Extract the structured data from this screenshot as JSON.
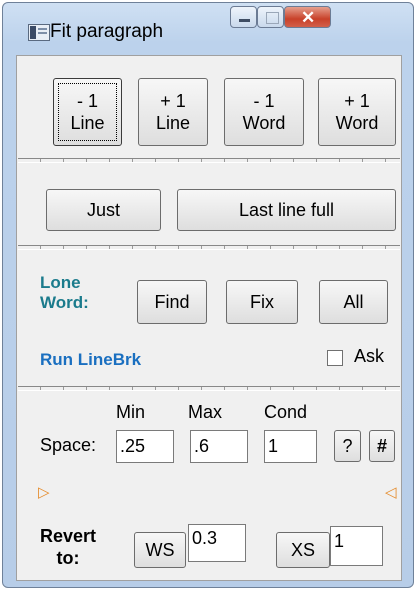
{
  "window": {
    "title": "Fit paragraph"
  },
  "row1": {
    "minus_line": [
      "- 1",
      "Line"
    ],
    "plus_line": [
      "+ 1",
      "Line"
    ],
    "minus_word": [
      "- 1",
      "Word"
    ],
    "plus_word": [
      "+ 1",
      "Word"
    ]
  },
  "row2": {
    "just": "Just",
    "last_line_full": "Last line full"
  },
  "lone_word": {
    "label_1": "Lone",
    "label_2": "Word:",
    "find": "Find",
    "fix": "Fix",
    "all": "All"
  },
  "run_linebrk": "Run LineBrk",
  "ask": {
    "label": "Ask",
    "checked": false
  },
  "space": {
    "label": "Space:",
    "min_label": "Min",
    "max_label": "Max",
    "cond_label": "Cond",
    "min_value": ".25",
    "max_value": ".6",
    "cond_value": "1",
    "help_button": "?",
    "hash_button": "#"
  },
  "markers": {
    "left": "▷",
    "right": "◁"
  },
  "revert": {
    "label_1": "Revert",
    "label_2": "to:",
    "ws_button": "WS",
    "ws_value": "0.3",
    "xs_button": "XS",
    "xs_value": "1"
  }
}
